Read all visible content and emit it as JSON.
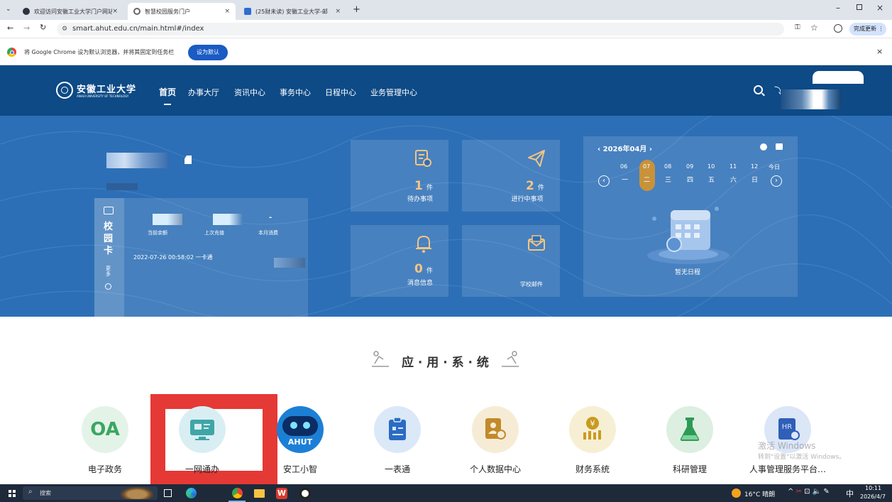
{
  "browser": {
    "tabs": [
      {
        "title": "欢迎访问安徽工业大学门户网站",
        "active": false
      },
      {
        "title": "智慧校园服务门户",
        "active": true
      },
      {
        "title": "(25财未读) 安徽工业大学-邮",
        "active": false
      }
    ],
    "url": "smart.ahut.edu.cn/main.html#/index",
    "update_button": "完成更新",
    "infobar_text": "将 Google Chrome 设为默认浏览器，并将其固定到任务栏",
    "infobar_button": "设为默认"
  },
  "site": {
    "logo_cn": "安徽工业大学",
    "logo_en": "ANHUI UNIVERSITY OF TECHNOLOGY",
    "nav": [
      "首页",
      "办事大厅",
      "资讯中心",
      "事务中心",
      "日程中心",
      "业务管理中心"
    ]
  },
  "card": {
    "title": "校园卡",
    "more": "更多",
    "stats": [
      "当前余额",
      "上次充值",
      "本月消费"
    ],
    "month_spend_value": "-",
    "last_txn": "2022-07-26 00:58:02 一卡通"
  },
  "tiles": [
    {
      "count": "1",
      "unit": "件",
      "label": "待办事项"
    },
    {
      "count": "2",
      "unit": "件",
      "label": "进行中事项"
    },
    {
      "count": "0",
      "unit": "件",
      "label": "消息信息"
    },
    {
      "count": "",
      "unit": "",
      "label": "学校邮件"
    }
  ],
  "calendar": {
    "month": "2026年04月",
    "dates": [
      "06",
      "07",
      "08",
      "09",
      "10",
      "11",
      "12",
      "今日"
    ],
    "weekdays": [
      "一",
      "二",
      "三",
      "四",
      "五",
      "六",
      "日"
    ],
    "empty": "暂无日程"
  },
  "apps_section": {
    "title": "应 · 用 · 系 · 统",
    "apps": [
      {
        "label": "电子政务",
        "icon": "OA"
      },
      {
        "label": "一网通办",
        "icon": "online-service-icon"
      },
      {
        "label": "安工小智",
        "icon": "AHUT"
      },
      {
        "label": "一表通",
        "icon": "form-icon"
      },
      {
        "label": "个人数据中心",
        "icon": "personal-data-icon"
      },
      {
        "label": "财务系统",
        "icon": "finance-icon"
      },
      {
        "label": "科研管理",
        "icon": "research-icon"
      },
      {
        "label": "人事管理服务平台…",
        "icon": "hr-icon"
      }
    ]
  },
  "watermark": {
    "line1": "激活 Windows",
    "line2": "转到\"设置\"以激活 Windows。"
  },
  "taskbar": {
    "search": "搜索",
    "weather": "16°C 晴朗",
    "ime": "中",
    "time": "10:11",
    "date": "2026/4/7"
  },
  "colors": {
    "header": "#0d4a86",
    "hero": "#2d6fb6",
    "highlight": "#e53935",
    "accent": "#c8923a"
  }
}
